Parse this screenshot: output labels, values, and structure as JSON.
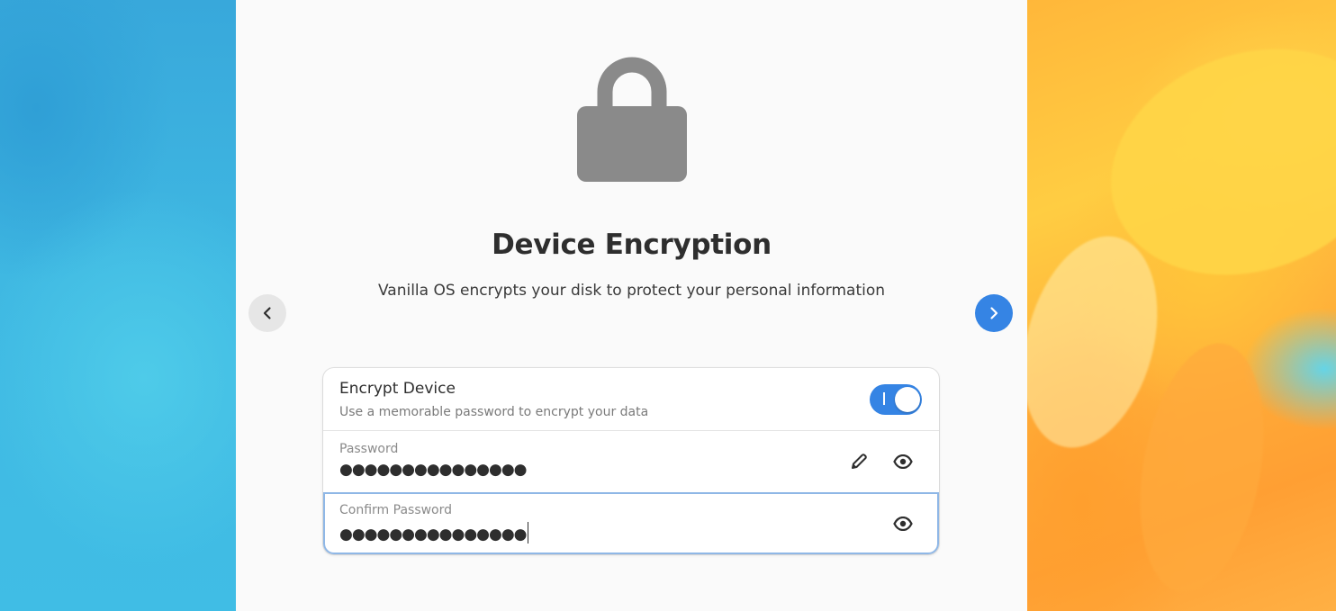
{
  "page": {
    "title": "Device Encryption",
    "subtitle": "Vanilla OS encrypts your disk to protect your personal information"
  },
  "icons": {
    "hero": "lock-icon",
    "back": "chevron-left-icon",
    "next": "chevron-right-icon",
    "edit": "pencil-icon",
    "reveal": "eye-icon"
  },
  "encrypt": {
    "title": "Encrypt Device",
    "subtitle": "Use a memorable password to encrypt your data",
    "enabled": true
  },
  "password": {
    "label": "Password",
    "value": "●●●●●●●●●●●●●●●"
  },
  "confirm": {
    "label": "Confirm Password",
    "value": "●●●●●●●●●●●●●●●"
  },
  "colors": {
    "accent": "#3584e4",
    "window_bg": "#fafafa",
    "lock_gray": "#8a8a8a",
    "focus_border": "#8fb7e6"
  }
}
